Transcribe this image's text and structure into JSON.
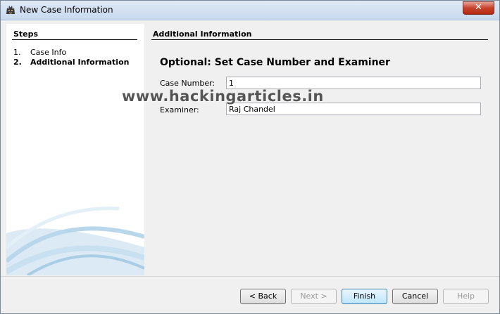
{
  "window": {
    "title": "New Case Information",
    "close_label": "✕"
  },
  "steps": {
    "title": "Steps",
    "items": [
      {
        "num": "1.",
        "label": "Case Info"
      },
      {
        "num": "2.",
        "label": "Additional Information"
      }
    ]
  },
  "panel": {
    "section_title": "Additional Information",
    "heading": "Optional: Set Case Number and Examiner",
    "case_number_label": "Case Number:",
    "case_number_value": "1",
    "examiner_label": "Examiner:",
    "examiner_value": "Raj Chandel"
  },
  "watermark": "www.hackingarticles.in",
  "buttons": {
    "back": "< Back",
    "next": "Next >",
    "finish": "Finish",
    "cancel": "Cancel",
    "help": "Help"
  }
}
